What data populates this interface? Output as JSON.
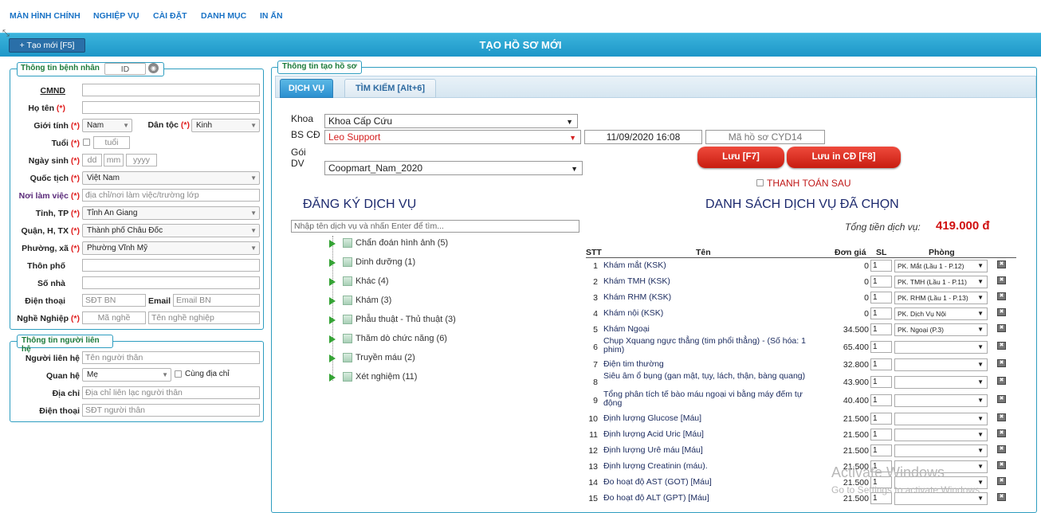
{
  "menu": {
    "items": [
      "MÀN HÌNH CHÍNH",
      "NGHIỆP VỤ",
      "CÀI ĐẶT",
      "DANH MỤC",
      "IN ẤN"
    ]
  },
  "header": {
    "title": "TẠO HỒ SƠ MỚI",
    "new_button": "+ Tạo mới [F5]"
  },
  "patient": {
    "legend": "Thông tin bệnh nhân",
    "id_label": "ID",
    "cmnd": "CMND",
    "ho_ten": "Họ tên",
    "gioi_tinh": "Giới tính",
    "gioi_tinh_value": "Nam",
    "dan_toc": "Dân tộc",
    "dan_toc_value": "Kinh",
    "tuoi": "Tuổi",
    "tuoi_placeholder": "tuổi",
    "ngay_sinh": "Ngày sinh",
    "dd": "dd",
    "mm": "mm",
    "yyyy": "yyyy",
    "quoc_tich": "Quốc tịch",
    "quoc_tich_value": "Việt Nam",
    "noi_lam_viec": "Nơi làm việc",
    "noi_lam_viec_placeholder": "địa chỉ/nơi làm việc/trường lớp",
    "tinh": "Tỉnh, TP",
    "tinh_value": "Tỉnh An Giang",
    "quan": "Quận, H, TX",
    "quan_value": "Thành phố Châu Đốc",
    "phuong": "Phường, xã",
    "phuong_value": "Phường Vĩnh Mỹ",
    "thon": "Thôn phố",
    "so_nha": "Số nhà",
    "dien_thoai": "Điện thoại",
    "dien_thoai_placeholder": "SĐT BN",
    "email": "Email",
    "email_placeholder": "Email BN",
    "nghe_nghiep": "Nghề Nghiệp",
    "ma_nghe_placeholder": "Mã nghề",
    "ten_nghe_placeholder": "Tên nghề nghiệp",
    "req": "(*)"
  },
  "contact": {
    "legend": "Thông tin người liên hệ",
    "nguoi_lien_he": "Người liên hệ",
    "nguoi_lien_he_placeholder": "Tên người thân",
    "quan_he": "Quan hệ",
    "quan_he_value": "Mẹ",
    "cung_dia_chi": "Cùng địa chỉ",
    "dia_chi": "Địa chỉ",
    "dia_chi_placeholder": "Địa chỉ liên lạc người thân",
    "dien_thoai": "Điện thoại",
    "dien_thoai_placeholder": "SĐT người thân"
  },
  "record": {
    "legend": "Thông tin tạo hồ sơ",
    "tabs": [
      "DỊCH VỤ",
      "TÌM KIẾM [Alt+6]"
    ],
    "khoa_label": "Khoa",
    "khoa_value": "Khoa Cấp Cứu",
    "bscd_label": "BS CĐ",
    "bscd_value": "Leo Support",
    "datetime": "11/09/2020 16:08",
    "ma_ho_so": "Mã hồ sơ CYD14",
    "goi_label": "Gói",
    "dv_label": "DV",
    "goi_value": "Coopmart_Nam_2020",
    "save_button": "Lưu [F7]",
    "save_print_button": "Lưu in CĐ [F8]",
    "thanh_toan_sau": "THANH TOÁN SAU"
  },
  "register": {
    "title": "ĐĂNG KÝ DỊCH VỤ",
    "search_placeholder": "Nhập tên dịch vụ và nhấn Enter để tìm...",
    "tree": [
      "Chẩn đoán hình ảnh (5)",
      "Dinh dưỡng (1)",
      "Khác (4)",
      "Khám (3)",
      "Phẫu thuật - Thủ thuật (3)",
      "Thăm dò chức năng (6)",
      "Truyền máu (2)",
      "Xét nghiệm (11)"
    ]
  },
  "selected": {
    "title": "DANH SÁCH DỊCH VỤ ĐÃ CHỌN",
    "total_label": "Tổng tiền dịch vụ:",
    "total_value": "419.000 đ",
    "headers": {
      "stt": "STT",
      "ten": "Tên",
      "don_gia": "Đơn giá",
      "sl": "SL",
      "phong": "Phòng"
    },
    "rows": [
      {
        "stt": "1",
        "name": "Khám mắt (KSK)",
        "price": "0",
        "qty": "1",
        "room": "PK. Mắt (Lầu 1 - P.12)"
      },
      {
        "stt": "2",
        "name": "Khám TMH (KSK)",
        "price": "0",
        "qty": "1",
        "room": "PK. TMH (Lầu 1 - P.11)"
      },
      {
        "stt": "3",
        "name": "Khám RHM (KSK)",
        "price": "0",
        "qty": "1",
        "room": "PK. RHM (Lầu 1 - P.13)"
      },
      {
        "stt": "4",
        "name": "Khám nội (KSK)",
        "price": "0",
        "qty": "1",
        "room": "PK. Dịch Vụ Nội"
      },
      {
        "stt": "5",
        "name": "Khám Ngoại",
        "price": "34.500",
        "qty": "1",
        "room": "PK. Ngoại (P.3)"
      },
      {
        "stt": "6",
        "name": "Chụp Xquang ngực thẳng (tim phổi thẳng) - (Số hóa: 1 phim)",
        "price": "65.400",
        "qty": "1",
        "room": ""
      },
      {
        "stt": "7",
        "name": "Điện tim thường",
        "price": "32.800",
        "qty": "1",
        "room": ""
      },
      {
        "stt": "8",
        "name": "Siêu âm ổ bụng (gan mật, tụy, lách, thận, bàng quang)",
        "price": "43.900",
        "qty": "1",
        "room": ""
      },
      {
        "stt": "9",
        "name": "Tổng phân tích tế bào máu ngoại vi bằng máy đếm tự động",
        "price": "40.400",
        "qty": "1",
        "room": ""
      },
      {
        "stt": "10",
        "name": "Định lượng Glucose [Máu]",
        "price": "21.500",
        "qty": "1",
        "room": ""
      },
      {
        "stt": "11",
        "name": "Định lượng Acid Uric [Máu]",
        "price": "21.500",
        "qty": "1",
        "room": ""
      },
      {
        "stt": "12",
        "name": "Định lượng Urê máu [Máu]",
        "price": "21.500",
        "qty": "1",
        "room": ""
      },
      {
        "stt": "13",
        "name": "Định lượng Creatinin (máu).",
        "price": "21.500",
        "qty": "1",
        "room": ""
      },
      {
        "stt": "14",
        "name": "Đo hoạt độ AST (GOT) [Máu]",
        "price": "21.500",
        "qty": "1",
        "room": ""
      },
      {
        "stt": "15",
        "name": "Đo hoạt độ ALT (GPT) [Máu]",
        "price": "21.500",
        "qty": "1",
        "room": ""
      }
    ]
  },
  "watermark": {
    "line1": "Activate Windows",
    "line2": "Go to Settings to activate Windows."
  }
}
